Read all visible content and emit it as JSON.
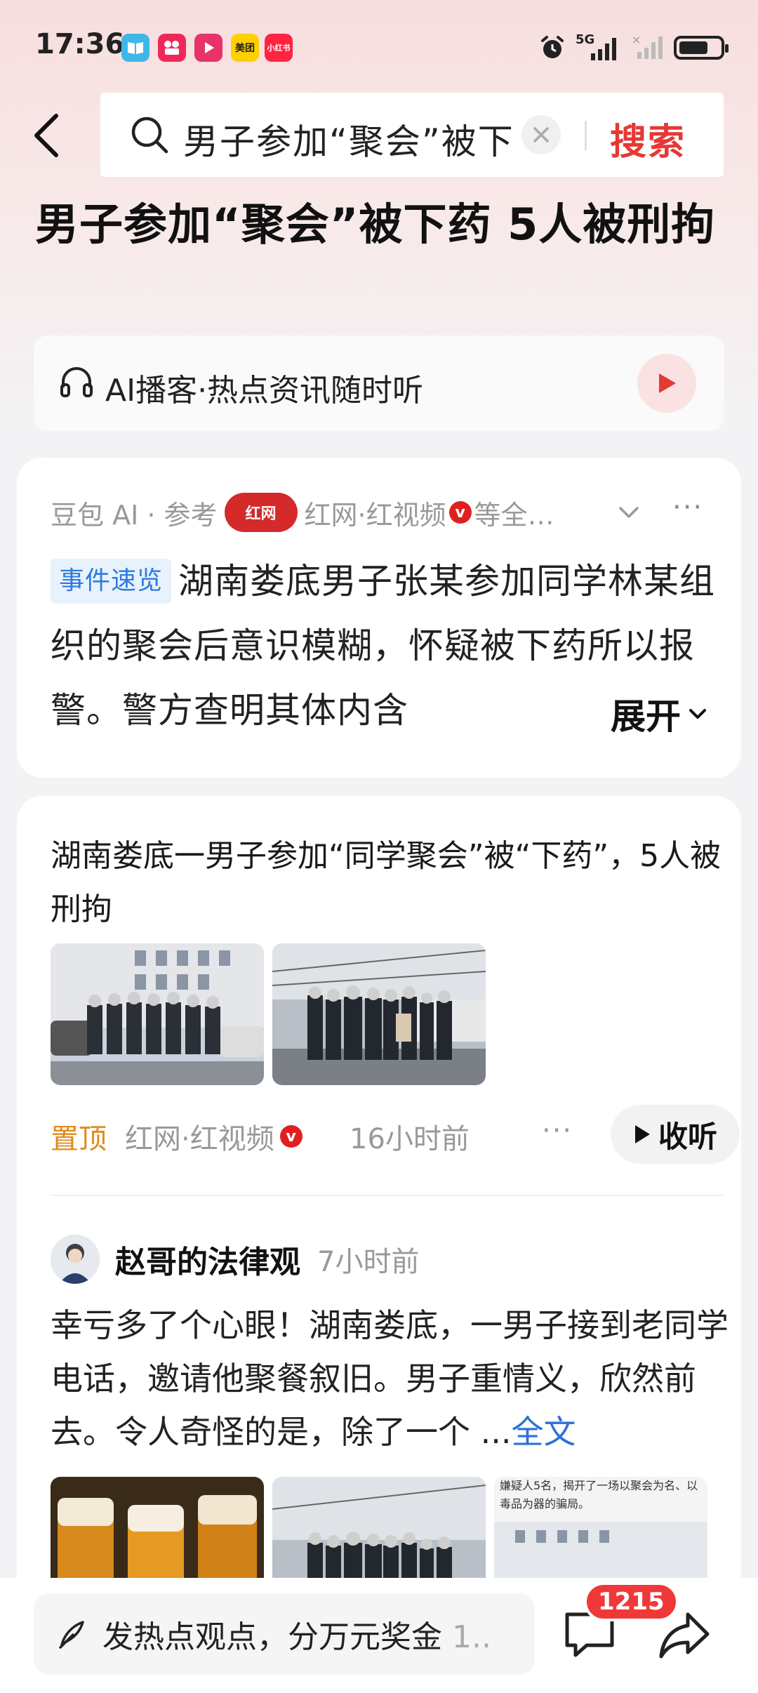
{
  "status_bar": {
    "time": "17:36",
    "apps": [
      {
        "name": "book-app-icon",
        "label": "",
        "color": "#3fb8e8"
      },
      {
        "name": "kuaishou-app-icon",
        "label": "",
        "color": "#f0285a"
      },
      {
        "name": "video-app-icon",
        "label": "",
        "color": "#e8326a"
      },
      {
        "name": "meituan-app-icon",
        "label": "美团",
        "color": "#ffd000"
      },
      {
        "name": "xiaohongshu-app-icon",
        "label": "小红书",
        "color": "#ff2442"
      }
    ],
    "network": "5G"
  },
  "search": {
    "query": "男子参加“聚会”被下",
    "submit_label": "搜索"
  },
  "page_title": "男子参加“聚会”被下药 5人被刑拘",
  "podcast": {
    "label": "AI播客·热点资讯随时听"
  },
  "ai_summary": {
    "source_prefix": "豆包 AI · 参考",
    "logo_text": "红网",
    "source_name": "红网·红视频",
    "source_suffix": "等全…",
    "tag": "事件速览",
    "text": "湖南娄底男子张某参加同学林某组织的聚会后意识模糊，怀疑被下药所以报警。警方查明其体内含",
    "expand_label": "展开"
  },
  "news_item": {
    "title": "湖南娄底一男子参加“同学聚会”被“下药”，5人被刑拘",
    "pin_label": "置顶",
    "source": "红网·红视频",
    "time": "16小时前",
    "listen_label": "收听"
  },
  "post": {
    "author": "赵哥的法律观",
    "time": "7小时前",
    "text": "幸亏多了个心眼！湖南娄底，一男子接到老同学电话，邀请他聚餐叙旧。男子重情义，欣然前去。令人奇怪的是，除了一个 ...",
    "full_link": "全文",
    "thumb3_caption": "嫌疑人5名，揭开了一场以聚会为名、以毒品为器的骗局。"
  },
  "bottom_bar": {
    "comment_placeholder": "发热点观点，分万元奖金",
    "comment_suffix": "1..",
    "comment_count": "1215"
  }
}
